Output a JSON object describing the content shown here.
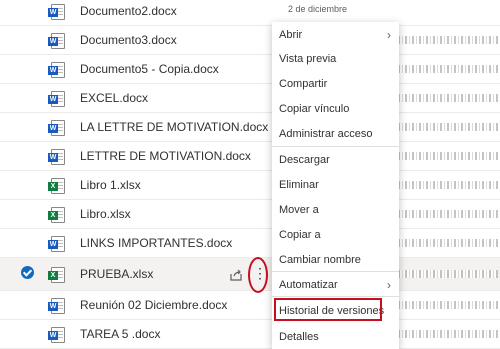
{
  "files": [
    {
      "name": "Documento2.docx",
      "type": "word",
      "date": "2 de diciembre"
    },
    {
      "name": "Documento3.docx",
      "type": "word",
      "date": ""
    },
    {
      "name": "Documento5 - Copia.docx",
      "type": "word",
      "date": ""
    },
    {
      "name": "EXCEL.docx",
      "type": "word",
      "date": ""
    },
    {
      "name": "LA LETTRE DE MOTIVATION.docx",
      "type": "word",
      "date": ""
    },
    {
      "name": "LETTRE DE MOTIVATION.docx",
      "type": "word",
      "date": ""
    },
    {
      "name": "Libro 1.xlsx",
      "type": "excel",
      "date": ""
    },
    {
      "name": "Libro.xlsx",
      "type": "excel",
      "date": ""
    },
    {
      "name": "LINKS IMPORTANTES.docx",
      "type": "word",
      "date": ""
    },
    {
      "name": "PRUEBA.xlsx",
      "type": "excel",
      "date": "",
      "selected": true
    },
    {
      "name": "Reunión 02 Diciembre.docx",
      "type": "word",
      "date": ""
    },
    {
      "name": "TAREA 5 .docx",
      "type": "word",
      "date": ""
    }
  ],
  "icon_tags": {
    "word": "W",
    "excel": "X"
  },
  "context_menu": {
    "items": [
      {
        "label": "Abrir",
        "submenu": true
      },
      {
        "label": "Vista previa"
      },
      {
        "label": "Compartir"
      },
      {
        "label": "Copiar vínculo"
      },
      {
        "label": "Administrar acceso"
      },
      {
        "label": "Descargar"
      },
      {
        "label": "Eliminar"
      },
      {
        "label": "Mover a"
      },
      {
        "label": "Copiar a"
      },
      {
        "label": "Cambiar nombre"
      },
      {
        "label": "Automatizar",
        "submenu": true
      },
      {
        "label": "Historial de versiones",
        "highlighted": true
      },
      {
        "label": "Detalles"
      }
    ]
  },
  "colors": {
    "highlight": "#c50f1f",
    "selection": "#0f6cbd",
    "word": "#185abd",
    "excel": "#107c41"
  },
  "icons": {
    "share": "share-icon",
    "more": "more-vertical-icon",
    "submenu": "chevron-right-icon",
    "selected": "checkmark-circle-icon"
  }
}
